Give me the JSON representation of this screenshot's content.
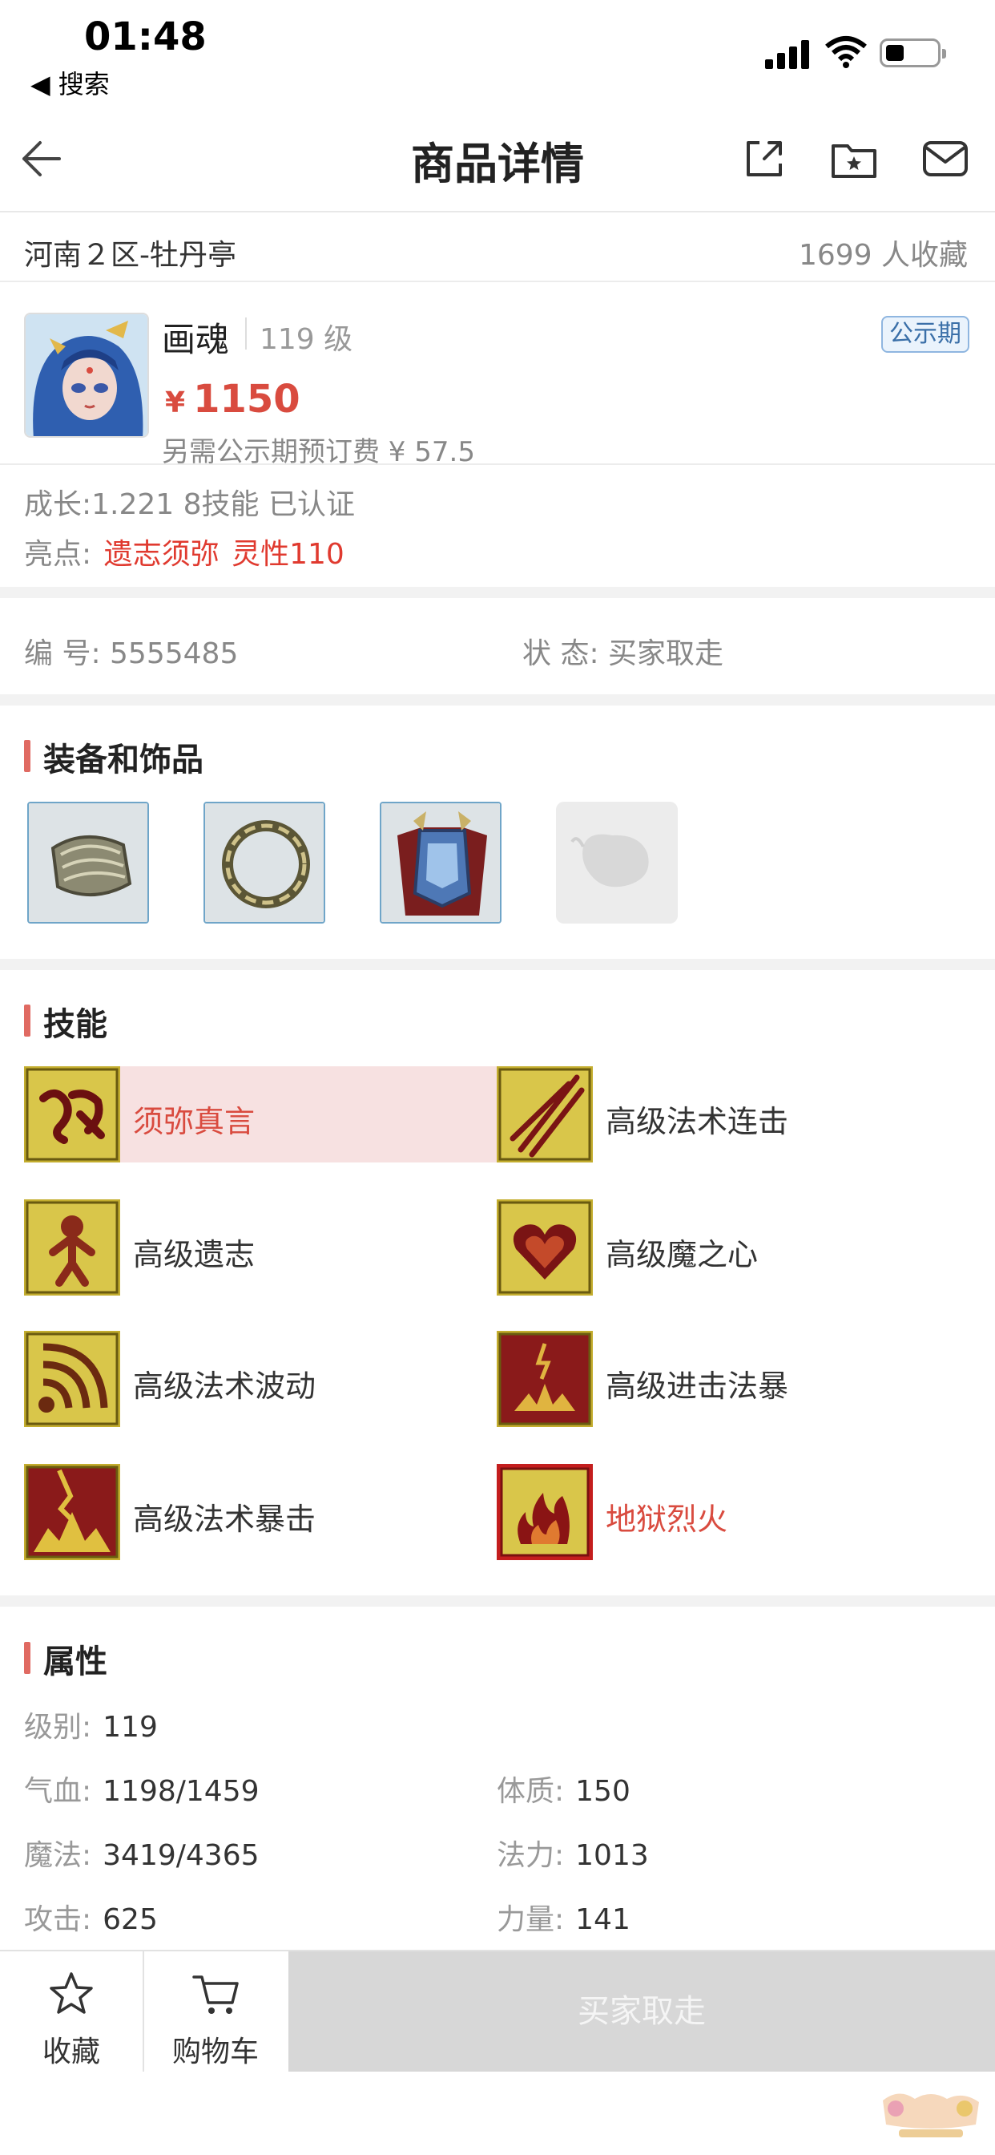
{
  "status_bar": {
    "time": "01:48",
    "back_app": "◀ 搜索"
  },
  "nav": {
    "title": "商品详情"
  },
  "listing": {
    "server": "河南２区-牡丹亭",
    "favorites": "1699 人收藏"
  },
  "pet": {
    "name": "画魂",
    "level": "119 级",
    "badge": "公示期",
    "currency": "¥",
    "price": "1150",
    "deposit": "另需公示期预订费 ¥ 57.5",
    "growth": "成长:1.221 8技能 已认证",
    "highlight_label": "亮点:",
    "highlight_1": "遗志须弥",
    "highlight_2": "灵性110"
  },
  "info": {
    "id_label": "编 号:",
    "id_value": "5555485",
    "status_label": "状 态:",
    "status_value": "买家取走"
  },
  "sections": {
    "equipment": "装备和饰品",
    "skills": "技能",
    "attributes": "属性"
  },
  "equipment": [
    {
      "icon": "bracer-icon"
    },
    {
      "icon": "ring-icon"
    },
    {
      "icon": "armor-icon"
    },
    {
      "icon": "empty-slot-icon"
    }
  ],
  "skills": [
    {
      "label": "须弥真言",
      "icon": "sumeru-mantra-icon",
      "highlighted": true
    },
    {
      "label": "高级法术连击",
      "icon": "spell-combo-icon",
      "highlighted": false
    },
    {
      "label": "高级遗志",
      "icon": "legacy-icon",
      "highlighted": false
    },
    {
      "label": "高级魔之心",
      "icon": "demon-heart-icon",
      "highlighted": false
    },
    {
      "label": "高级法术波动",
      "icon": "spell-wave-icon",
      "highlighted": false
    },
    {
      "label": "高级进击法暴",
      "icon": "assault-crit-icon",
      "highlighted": false
    },
    {
      "label": "高级法术暴击",
      "icon": "spell-crit-icon",
      "highlighted": false
    },
    {
      "label": "地狱烈火",
      "icon": "hellfire-icon",
      "highlighted": true
    }
  ],
  "attributes": {
    "level_label": "级别:",
    "level": "119",
    "hp_label": "气血:",
    "hp": "1198/1459",
    "con_label": "体质:",
    "con": "150",
    "mp_label": "魔法:",
    "mp": "3419/4365",
    "mag_label": "法力:",
    "mag": "1013",
    "atk_label": "攻击:",
    "atk": "625",
    "str_label": "力量:",
    "str": "141"
  },
  "bottom": {
    "favorite": "收藏",
    "cart": "购物车",
    "buy": "买家取走"
  },
  "colors": {
    "accent_red": "#d94b3f",
    "section_bar": "#e06a62",
    "disabled_button": "#d7d7d7"
  }
}
